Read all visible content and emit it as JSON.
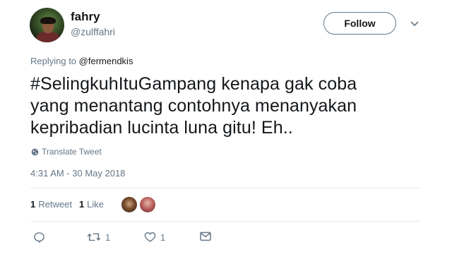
{
  "user": {
    "display_name": "fahry",
    "handle": "@zulffahri"
  },
  "follow_button": {
    "label": "Follow"
  },
  "reply": {
    "prefix": "Replying to",
    "mention": "@fermendkis"
  },
  "tweet": {
    "text": "#SelingkuhItuGampang kenapa gak coba\nyang menantang contohnya menanyakan\nkepribadian lucinta luna gitu! Eh..",
    "translate_label": "Translate Tweet",
    "timestamp": "4:31 AM - 30 May 2018"
  },
  "stats": {
    "retweets_count": "1",
    "retweets_label": "Retweet",
    "likes_count": "1",
    "likes_label": "Like"
  },
  "actions": {
    "reply_icon": "reply-icon",
    "retweet_icon": "retweet-icon",
    "retweet_count": "1",
    "like_icon": "heart-icon",
    "like_count": "1",
    "dm_icon": "envelope-icon"
  },
  "colors": {
    "text_primary": "#14171a",
    "text_secondary": "#657786",
    "divider": "#e6ecf0"
  }
}
